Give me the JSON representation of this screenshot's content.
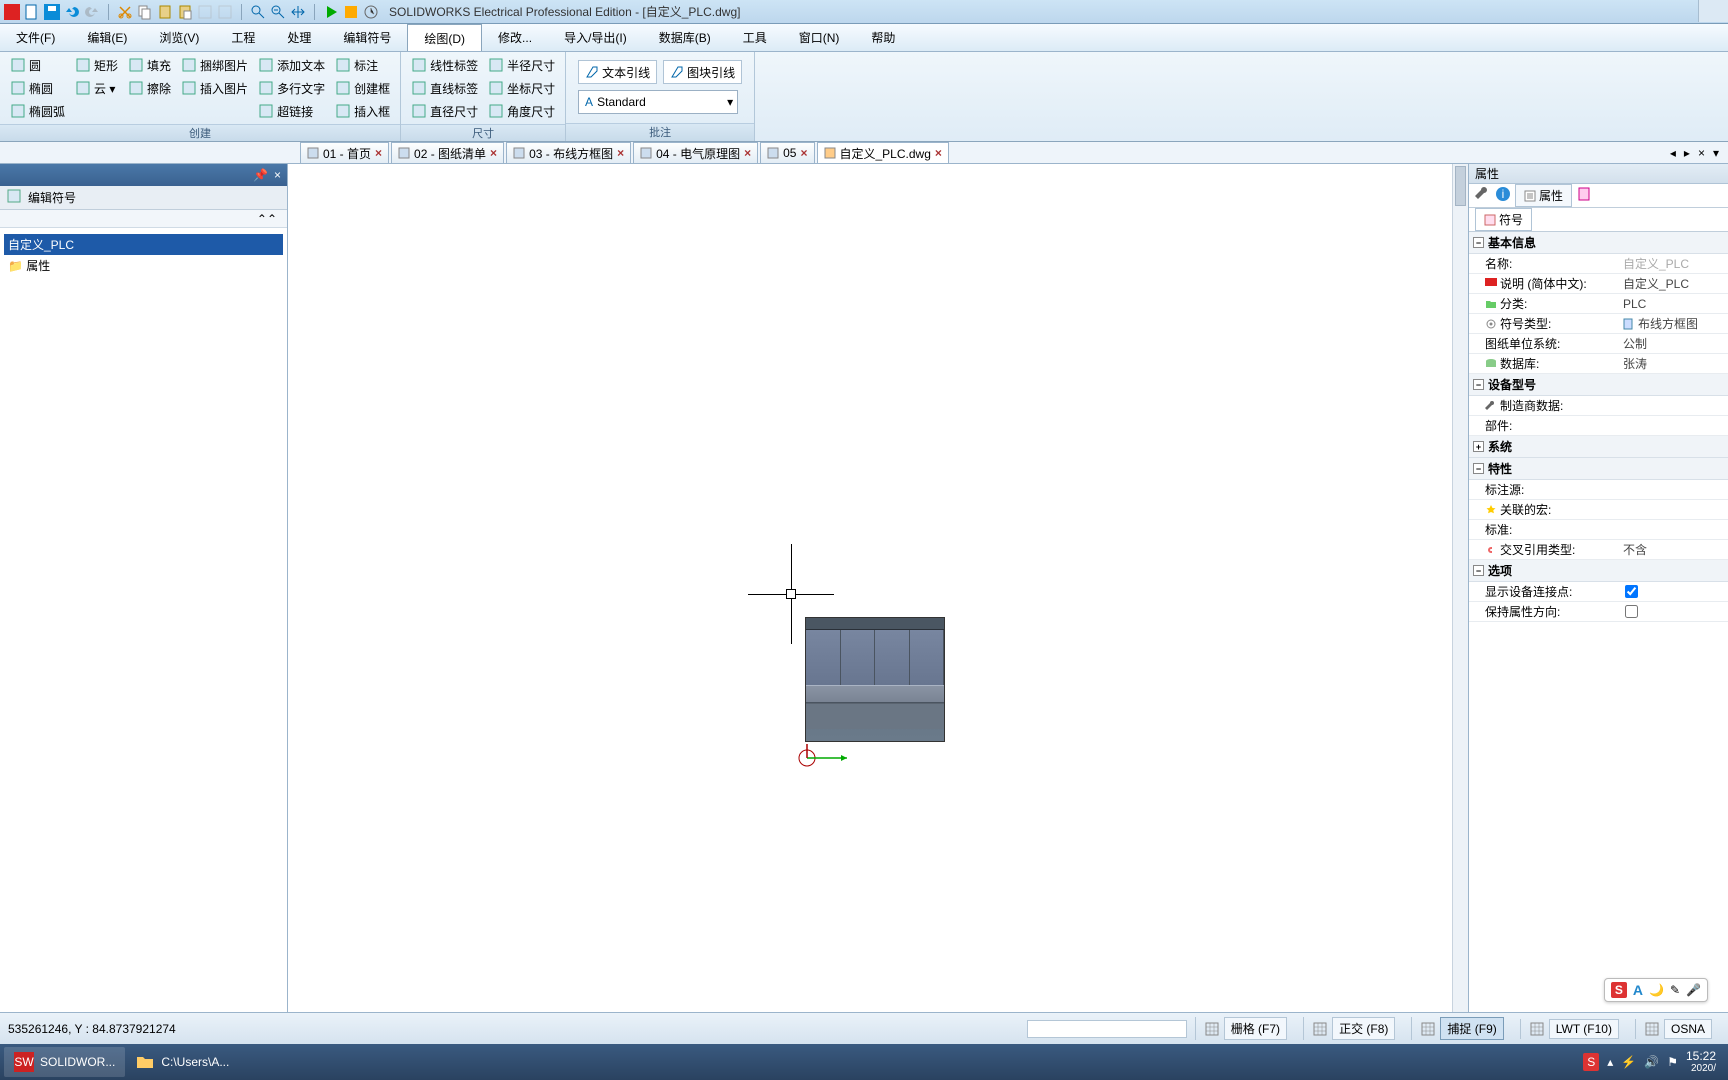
{
  "app": {
    "title": "SOLIDWORKS Electrical Professional Edition - [自定义_PLC.dwg]"
  },
  "menu": {
    "items": [
      "文件(F)",
      "编辑(E)",
      "浏览(V)",
      "工程",
      "处理",
      "编辑符号",
      "绘图(D)",
      "修改...",
      "导入/导出(I)",
      "数据库(B)",
      "工具",
      "窗口(N)",
      "帮助"
    ],
    "active_index": 6
  },
  "ribbon": {
    "groups": [
      {
        "label": "创建",
        "cols": [
          [
            "圆",
            "椭圆",
            "椭圆弧"
          ],
          [
            "矩形",
            "云 ▾",
            ""
          ],
          [
            "填充",
            "擦除",
            ""
          ],
          [
            "捆绑图片",
            "插入图片",
            ""
          ],
          [
            "添加文本",
            "多行文字",
            "超链接"
          ],
          [
            "标注",
            "创建框",
            "插入框"
          ]
        ]
      },
      {
        "label": "尺寸",
        "cols": [
          [
            "线性标签",
            "直线标签",
            "直径尺寸"
          ],
          [
            "半径尺寸",
            "坐标尺寸",
            "角度尺寸"
          ]
        ]
      },
      {
        "label": "批注",
        "anno": {
          "btn1": "文本引线",
          "btn2": "图块引线",
          "combo": "Standard"
        }
      }
    ]
  },
  "doctabs": {
    "tabs": [
      {
        "label": "01 - 首页",
        "close": true
      },
      {
        "label": "02 - 图纸清单",
        "close": true
      },
      {
        "label": "03 - 布线方框图",
        "close": true
      },
      {
        "label": "04 - 电气原理图",
        "close": true
      },
      {
        "label": "05",
        "close": true
      },
      {
        "label": "自定义_PLC.dwg",
        "close": true,
        "active": true
      }
    ]
  },
  "leftpanel": {
    "header": "",
    "tab": "编辑符号",
    "collapse": "⌃",
    "tree": [
      {
        "label": "自定义_PLC",
        "sel": true
      },
      {
        "label": "属性",
        "sel": false
      }
    ],
    "pin": "📌",
    "x": "×"
  },
  "rightpanel": {
    "header": "属性",
    "tabs": [
      "属性"
    ],
    "subtab": "符号",
    "groups": [
      {
        "title": "基本信息",
        "rows": [
          {
            "k": "名称:",
            "v": "自定义_PLC",
            "dim": true
          },
          {
            "k": "说明 (简体中文):",
            "v": "自定义_PLC",
            "ico": "flag-red"
          },
          {
            "k": "分类:",
            "v": "PLC",
            "ico": "folder"
          },
          {
            "k": "符号类型:",
            "v": "布线方框图",
            "ico": "gear",
            "vico": "doc"
          },
          {
            "k": "图纸单位系统:",
            "v": "公制"
          },
          {
            "k": "数据库:",
            "v": "张涛",
            "ico": "db"
          }
        ]
      },
      {
        "title": "设备型号",
        "rows": [
          {
            "k": "制造商数据:",
            "v": "",
            "ico": "wrench"
          },
          {
            "k": "部件:",
            "v": ""
          }
        ]
      },
      {
        "title": "系统",
        "rows": [],
        "collapsed": true
      },
      {
        "title": "特性",
        "rows": [
          {
            "k": "标注源:",
            "v": ""
          },
          {
            "k": "关联的宏:",
            "v": "",
            "ico": "star"
          },
          {
            "k": "标准:",
            "v": ""
          },
          {
            "k": "交叉引用类型:",
            "v": "不含",
            "ico": "link"
          }
        ]
      },
      {
        "title": "选项",
        "rows": [
          {
            "k": "显示设备连接点:",
            "v": "",
            "chk": true,
            "checked": true
          },
          {
            "k": "保持属性方向:",
            "v": "",
            "chk": true,
            "checked": false
          }
        ]
      }
    ]
  },
  "status": {
    "coords": "535261246, Y : 84.8737921274",
    "btns": [
      {
        "label": "栅格 (F7)",
        "active": false
      },
      {
        "label": "正交 (F8)",
        "active": false
      },
      {
        "label": "捕捉 (F9)",
        "active": true
      },
      {
        "label": "LWT (F10)",
        "active": false
      },
      {
        "label": "OSNA",
        "active": false
      }
    ]
  },
  "taskbar": {
    "items": [
      {
        "label": "SOLIDWOR...",
        "ico": "sw"
      },
      {
        "label": "C:\\Users\\A...",
        "ico": "folder"
      }
    ],
    "clock": {
      "t": "15:22",
      "d": "2020/"
    }
  },
  "ime": {
    "items": [
      "S",
      "A",
      "🌙",
      "✎",
      "🎤"
    ]
  }
}
